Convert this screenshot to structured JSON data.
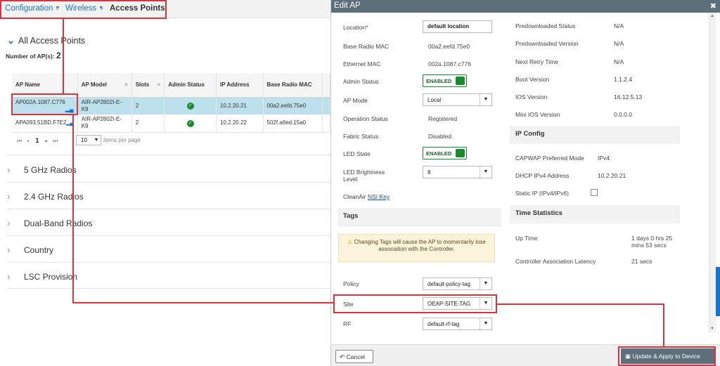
{
  "breadcrumb": {
    "item1": "Configuration",
    "item2": "Wireless",
    "current": "Access Points"
  },
  "left": {
    "section_title": "All Access Points",
    "ap_count_label": "Number of AP(s):",
    "ap_count": "2",
    "columns": [
      "AP Name",
      "AP Model",
      "Slots",
      "Admin Status",
      "IP Address",
      "Base Radio MAC"
    ],
    "rows": [
      {
        "name": "AP002A.1087.C776",
        "model": "AIR-AP2802I-E-K9",
        "slots": "2",
        "ip": "10.2.20.21",
        "mac": "00a2.eefd.75e0"
      },
      {
        "name": "APA093.51BD.F7E2",
        "model": "AIR-AP2802I-E-K9",
        "slots": "2",
        "ip": "10.2.20.22",
        "mac": "502f.a8ed.15a0"
      }
    ],
    "pagination": {
      "page": "1",
      "per_page": "10",
      "per_page_label": "items per page"
    },
    "sections": [
      "5 GHz Radios",
      "2.4 GHz Radios",
      "Dual-Band Radios",
      "Country",
      "LSC Provision"
    ]
  },
  "panel": {
    "title": "Edit AP",
    "location_label": "Location*",
    "location_value": "default location",
    "base_mac_label": "Base Radio MAC",
    "base_mac_value": "00a2.eefd.75e0",
    "eth_mac_label": "Ethernet MAC",
    "eth_mac_value": "002a.1087.c776",
    "admin_status_label": "Admin Status",
    "admin_status_value": "ENABLED",
    "ap_mode_label": "AP Mode",
    "ap_mode_value": "Local",
    "op_status_label": "Operation Status",
    "op_status_value": "Registered",
    "fabric_label": "Fabric Status",
    "fabric_value": "Disabled",
    "led_state_label": "LED State",
    "led_state_value": "ENABLED",
    "led_bright_label": "LED Brightness Level",
    "led_bright_value": "8",
    "cleanair_label": "CleanAir",
    "cleanair_link": "NSI Key",
    "tags_title": "Tags",
    "tags_warning": "Changing Tags will cause the AP to momentarily lose association with the Controller.",
    "policy_label": "Policy",
    "policy_value": "default-policy-tag",
    "site_label": "Site",
    "site_value": "OEAP-SITE-TAG",
    "rf_label": "RF",
    "rf_value": "default-rf-tag",
    "predl_status_label": "Predownloaded Status",
    "predl_status_value": "N/A",
    "predl_version_label": "Predownloaded Version",
    "predl_version_value": "N/A",
    "next_retry_label": "Next Retry Time",
    "next_retry_value": "N/A",
    "boot_label": "Boot Version",
    "boot_value": "1.1.2.4",
    "ios_label": "IOS Version",
    "ios_value": "16.12.5.13",
    "mini_ios_label": "Mini IOS Version",
    "mini_ios_value": "0.0.0.0",
    "ip_config_title": "IP Config",
    "capwap_label": "CAPWAP Preferred Mode",
    "capwap_value": "IPv4",
    "dhcp_label": "DHCP IPv4 Address",
    "dhcp_value": "10.2.20.21",
    "static_ip_label": "Static IP (IPv4/IPv6)",
    "time_title": "Time Statistics",
    "uptime_label": "Up Time",
    "uptime_value": "1 days 0 hrs 25 mins 53 secs",
    "latency_label": "Controller Association Latency",
    "latency_value": "21 secs",
    "cancel_label": "Cancel",
    "update_label": "Update & Apply to Device"
  }
}
